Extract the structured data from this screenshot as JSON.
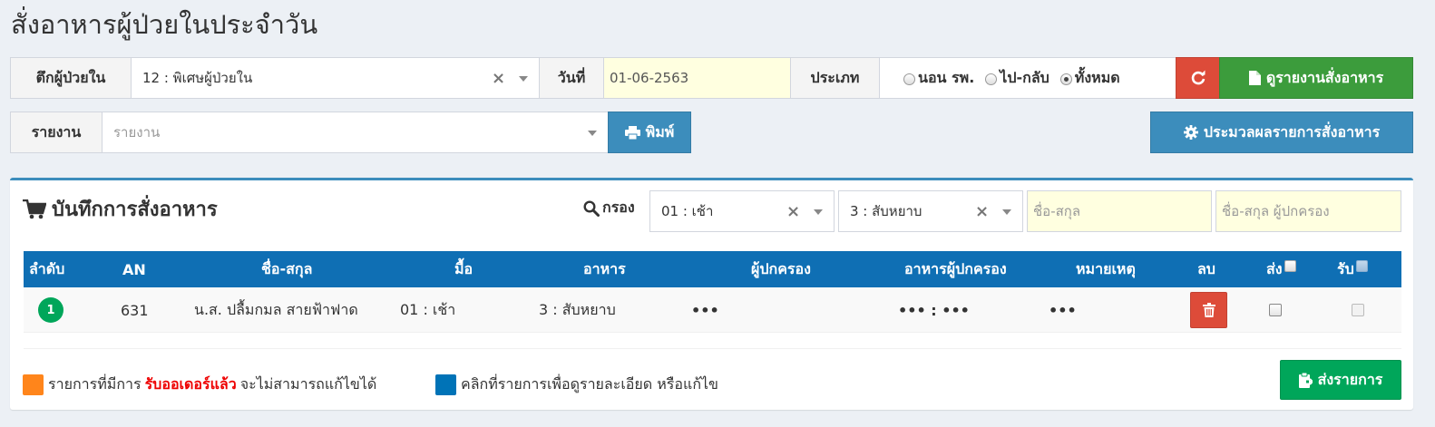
{
  "page": {
    "title": "สั่งอาหารผู้ป่วยในประจำวัน"
  },
  "filters": {
    "ward_label": "ตึกผู้ป่วยใน",
    "ward_value": "12 : พิเศษผู้ป่วยใน",
    "date_label": "วันที่",
    "date_value": "01-06-2563",
    "type_label": "ประเภท",
    "type_options": [
      "นอน รพ.",
      "ไป-กลับ",
      "ทั้งหมด"
    ],
    "type_selected": "ทั้งหมด",
    "report_button": "ดูรายงานสั่งอาหาร",
    "report_label": "รายงาน",
    "report_placeholder": "รายงาน",
    "print_button": "พิมพ์",
    "process_button": "ประมวลผลรายการสั่งอาหาร"
  },
  "panel": {
    "title": "บันทึกการสั่งอาหาร",
    "filter_label": "กรอง",
    "meal_filter": "01 : เช้า",
    "diet_filter": "3 : สับหยาบ",
    "name_placeholder": "ชื่อ-สกุล",
    "guardian_placeholder": "ชื่อ-สกุล ผู้ปกครอง"
  },
  "table": {
    "columns": [
      "ลำดับ",
      "AN",
      "ชื่อ-สกุล",
      "มื้อ",
      "อาหาร",
      "ผู้ปกครอง",
      "อาหารผู้ปกครอง",
      "หมายเหตุ",
      "ลบ",
      "ส่ง",
      "รับ"
    ],
    "rows": [
      {
        "no": "1",
        "an": "631",
        "name": "น.ส. ปลื้มกมล สายฟ้าฟาด",
        "meal": "01 : เช้า",
        "food": "3 : สับหยาบ",
        "guardian": "•••",
        "guardian_food": "••• : •••",
        "note": "•••",
        "send": false,
        "receive": false
      }
    ]
  },
  "legend": {
    "orange_prefix": "รายการที่มีการ",
    "orange_highlight": "รับออเดอร์แล้ว",
    "orange_suffix": "จะไม่สามารถแก้ไขได้",
    "blue_text": "คลิกที่รายการเพื่อดูรายละเอียด หรือแก้ไข"
  },
  "submit_button": "ส่งรายการ",
  "colors": {
    "header_blue": "#0f6fb4",
    "accent_blue": "#3c8dbc",
    "green": "#00a65a",
    "red": "#dd4b39",
    "orange": "#ff851b",
    "legend_blue": "#0073b7",
    "input_yellow": "#ffffe0"
  }
}
